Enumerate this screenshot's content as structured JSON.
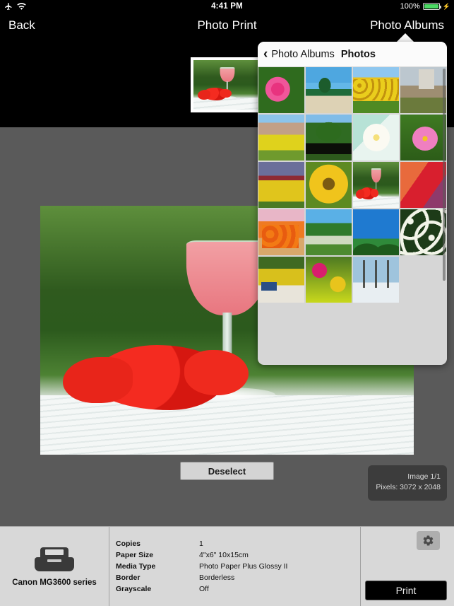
{
  "statusbar": {
    "airplane_icon": "airplane-mode-icon",
    "wifi_icon": "wifi-icon",
    "time": "4:41 PM",
    "battery_percent": "100%",
    "battery_level": 100,
    "charging_icon": "lightning-bolt-icon"
  },
  "navbar": {
    "back_label": "Back",
    "title": "Photo Print",
    "right_label": "Photo Albums"
  },
  "popover": {
    "back_chevron_icon": "chevron-left-icon",
    "back_label": "Photo Albums",
    "title": "Photos",
    "photos": [
      {
        "name": "pink-hibiscus",
        "style": "ph-pinkhibiscus"
      },
      {
        "name": "palm-beach",
        "style": "ph-beach"
      },
      {
        "name": "sunflower-field",
        "style": "ph-sunfield"
      },
      {
        "name": "church-garden",
        "style": "ph-church"
      },
      {
        "name": "village-rapeseed",
        "style": "ph-village"
      },
      {
        "name": "lone-tree",
        "style": "ph-tree"
      },
      {
        "name": "plumeria-flower",
        "style": "ph-plumeria"
      },
      {
        "name": "pink-cosmos",
        "style": "ph-cosmos"
      },
      {
        "name": "tulip-field",
        "style": "ph-tulipfield"
      },
      {
        "name": "sunflower-closeup",
        "style": "ph-sunflower"
      },
      {
        "name": "cocktail-hibiscus",
        "style": "ph-cocktail"
      },
      {
        "name": "red-tulip-closeup",
        "style": "ph-tulipclose"
      },
      {
        "name": "flower-bouquet",
        "style": "ph-bouquet"
      },
      {
        "name": "beach-tree",
        "style": "ph-beachtree"
      },
      {
        "name": "palms-blue-sky",
        "style": "ph-palmsky"
      },
      {
        "name": "white-daisies",
        "style": "ph-daisy"
      },
      {
        "name": "flower-market",
        "style": "ph-market"
      },
      {
        "name": "mixed-flowers",
        "style": "ph-mixflowers"
      },
      {
        "name": "winter-trees",
        "style": "ph-winter"
      }
    ]
  },
  "filmstrip": {
    "selected_photo": "cocktail-hibiscus"
  },
  "preview": {
    "photo": "cocktail-hibiscus",
    "deselect_label": "Deselect",
    "image_index": "Image 1/1",
    "pixels": "Pixels: 3072 x 2048"
  },
  "bottom": {
    "printer_icon": "printer-icon",
    "printer_name": "Canon MG3600 series",
    "settings": [
      {
        "key": "Copies",
        "value": "1"
      },
      {
        "key": "Paper Size",
        "value": "4\"x6\"  10x15cm"
      },
      {
        "key": "Media Type",
        "value": "Photo Paper Plus Glossy II"
      },
      {
        "key": "Border",
        "value": "Borderless"
      },
      {
        "key": "Grayscale",
        "value": "Off"
      }
    ],
    "gear_icon": "gear-icon",
    "print_label": "Print"
  },
  "colors": {
    "canvas": "#5a5a5a",
    "panel": "#d8d8d8",
    "popover": "#d6d6d6",
    "battery_green": "#4cd964",
    "black": "#000000"
  }
}
